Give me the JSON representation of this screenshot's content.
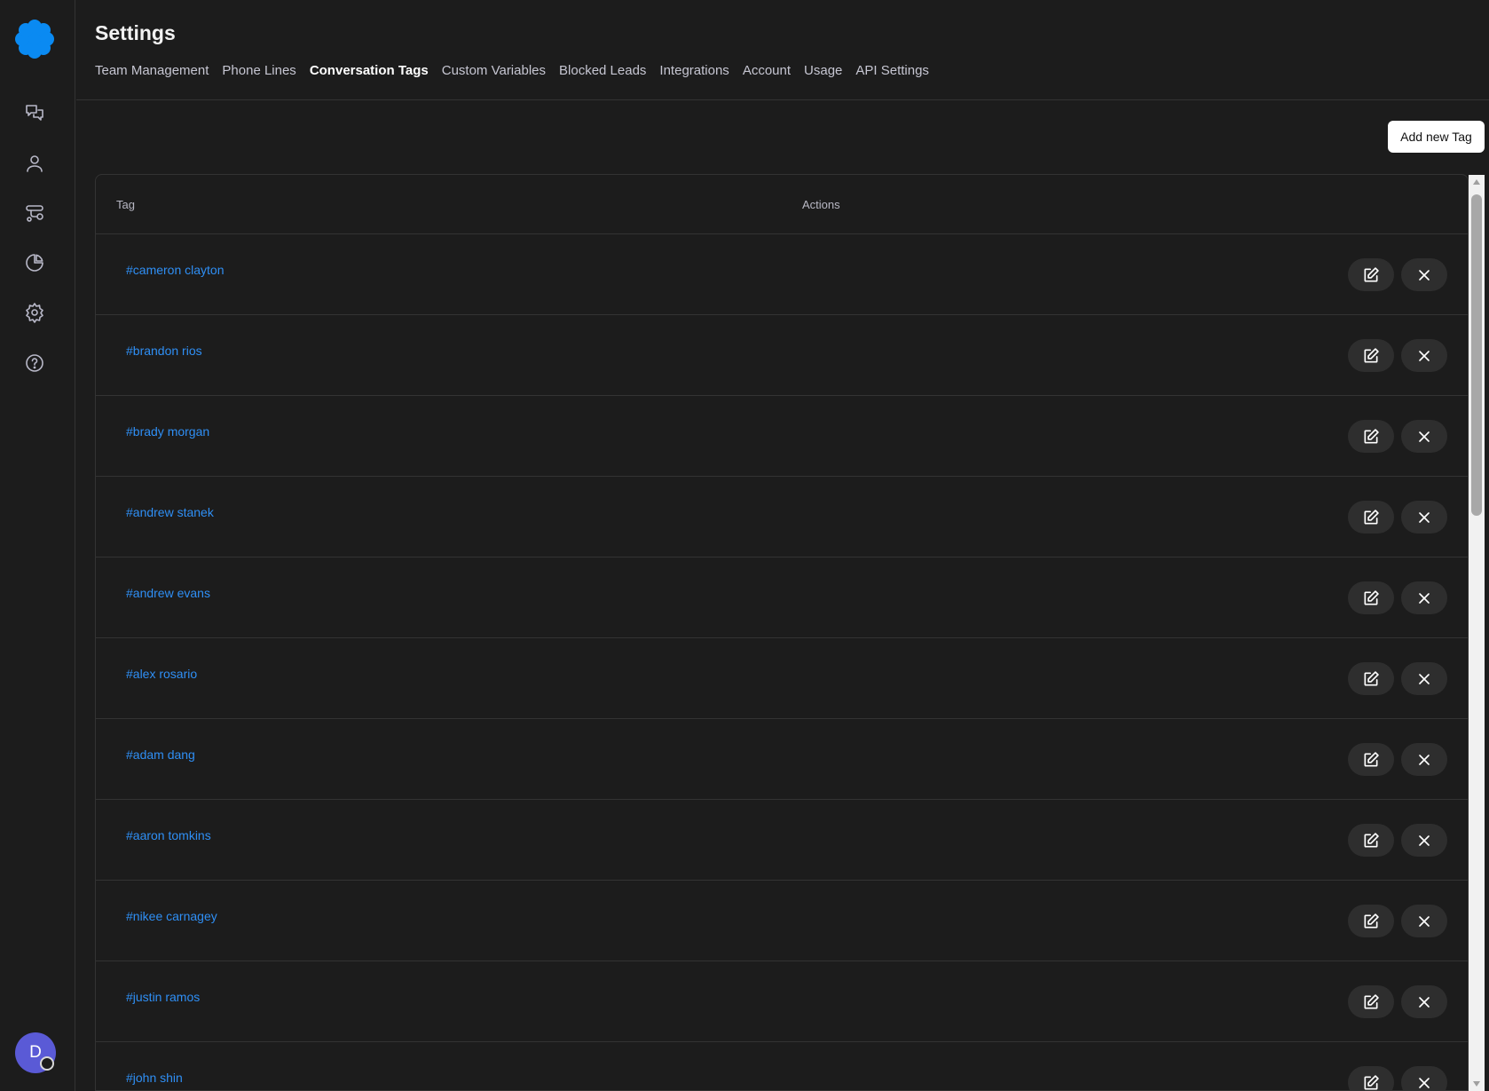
{
  "header": {
    "title": "Settings",
    "tabs": [
      {
        "label": "Team Management",
        "active": false
      },
      {
        "label": "Phone Lines",
        "active": false
      },
      {
        "label": "Conversation Tags",
        "active": true
      },
      {
        "label": "Custom Variables",
        "active": false
      },
      {
        "label": "Blocked Leads",
        "active": false
      },
      {
        "label": "Integrations",
        "active": false
      },
      {
        "label": "Account",
        "active": false
      },
      {
        "label": "Usage",
        "active": false
      },
      {
        "label": "API Settings",
        "active": false
      }
    ]
  },
  "sidebar": {
    "icons": [
      "conversations-icon",
      "contacts-icon",
      "workflows-icon",
      "analytics-icon",
      "settings-icon",
      "help-icon"
    ],
    "avatar_initial": "D"
  },
  "toolbar": {
    "add_label": "Add new Tag"
  },
  "table": {
    "columns": [
      "Tag",
      "Actions"
    ],
    "rows": [
      {
        "tag": "#cameron clayton"
      },
      {
        "tag": "#brandon rios"
      },
      {
        "tag": "#brady morgan"
      },
      {
        "tag": "#andrew stanek"
      },
      {
        "tag": "#andrew evans"
      },
      {
        "tag": "#alex rosario"
      },
      {
        "tag": "#adam dang"
      },
      {
        "tag": "#aaron tomkins"
      },
      {
        "tag": "#nikee carnagey"
      },
      {
        "tag": "#justin ramos"
      },
      {
        "tag": "#john shin"
      }
    ]
  },
  "colors": {
    "background": "#1c1c1c",
    "accent": "#2f8ff5",
    "logo": "#0a8af2",
    "avatar": "#5a5ad6"
  }
}
